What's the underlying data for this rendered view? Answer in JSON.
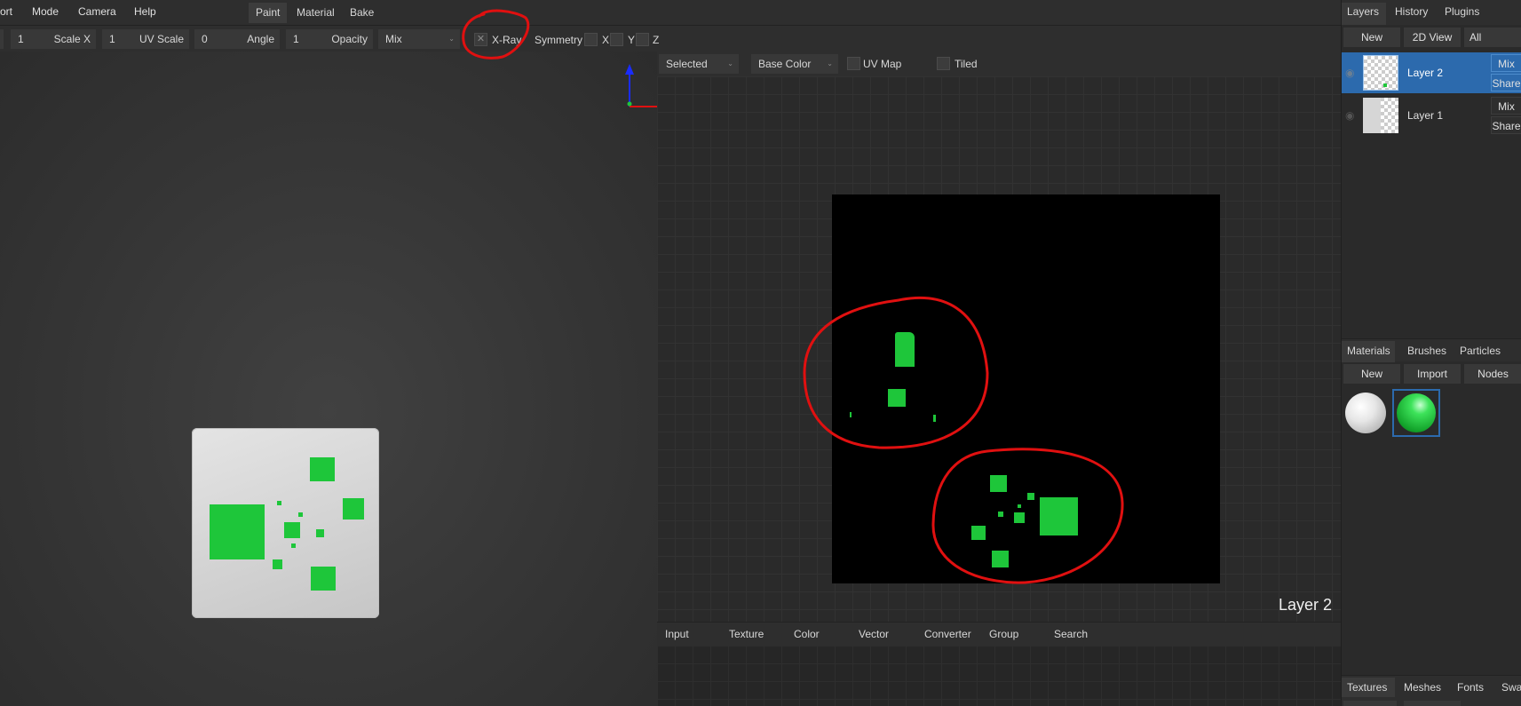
{
  "menu": {
    "items": [
      "ort",
      "Mode",
      "Camera",
      "Help"
    ],
    "workspace_tabs": [
      "Paint",
      "Material",
      "Bake"
    ]
  },
  "toolbar": {
    "field1_value": "1",
    "scale_x_value": "1",
    "scale_x_label": "Scale X",
    "uv_scale_value": "1",
    "uv_scale_label": "UV Scale",
    "angle_value": "0",
    "angle_label": "Angle",
    "opacity_value": "1",
    "opacity_label": "Opacity",
    "blend_value": "Mix",
    "xray_label": "X-Ray",
    "symmetry_label": "Symmetry",
    "sym_x": "X",
    "sym_y": "Y",
    "sym_z": "Z"
  },
  "view2d": {
    "mode_select": "Selected",
    "channel_select": "Base Color",
    "uvmap_label": "UV Map",
    "tiled_label": "Tiled",
    "overlay_label": "Layer 2"
  },
  "nodebar": {
    "items": [
      "Input",
      "Texture",
      "Color",
      "Vector",
      "Converter",
      "Group",
      "Search"
    ]
  },
  "right": {
    "tabs_top": [
      "Layers",
      "History",
      "Plugins"
    ],
    "new_button": "New",
    "view_button": "2D View",
    "filter_button": "All",
    "layers": [
      {
        "name": "Layer 2",
        "blend": "Mix",
        "share": "Share"
      },
      {
        "name": "Layer 1",
        "blend": "Mix",
        "share": "Share"
      }
    ],
    "tabs_mid": [
      "Materials",
      "Brushes",
      "Particles"
    ],
    "mat_new": "New",
    "mat_import": "Import",
    "mat_nodes": "Nodes",
    "tabs_bottom": [
      "Textures",
      "Meshes",
      "Fonts",
      "Swat"
    ]
  },
  "colors": {
    "accent": "#2c6aad",
    "paint_green": "#1ec63a",
    "annotation_red": "#e01010"
  }
}
